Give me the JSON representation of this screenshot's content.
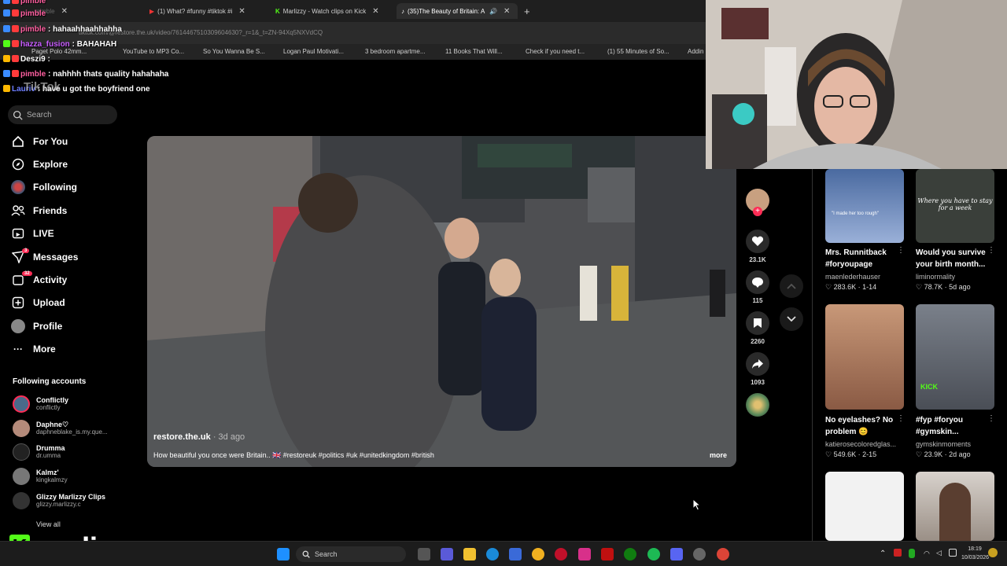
{
  "browser": {
    "tabs": [
      {
        "title": "pimble",
        "active": false
      },
      {
        "title": "(1) What? #funny #tiktok #i",
        "active": false
      },
      {
        "title": "Marlizzy - Watch clips on Kick",
        "active": false
      },
      {
        "title": "(35)The Beauty of Britain: A",
        "active": true
      }
    ],
    "new_tab": "+",
    "url": "tiktok.com/@restore.the.uk/video/7614467510309604630?_r=1&_t=ZN-94Xq5NXVdCQ",
    "bookmarks": [
      "Paget Polo 42mm...",
      "YouTube to MP3 Co...",
      "So You Wanna Be S...",
      "Logan Paul Motivati...",
      "3 bedroom apartme...",
      "11 Books That Will...",
      "Check if you need t...",
      "(1) 55 Minutes of So...",
      "Addin"
    ]
  },
  "chat": [
    {
      "user": "pimble",
      "message": "",
      "color": "#ff5fa0"
    },
    {
      "user": "pimble",
      "message": "hahaahhaahhahha",
      "color": "#ff5fa0"
    },
    {
      "user": "hazza_fusion",
      "message": "BAHAHAH",
      "color": "#c85cff"
    },
    {
      "user": "Deszi9",
      "message": "",
      "color": "#ffffff"
    },
    {
      "user": "pimble",
      "message": "nahhhh thats quality hahahaha",
      "color": "#ff5fa0"
    },
    {
      "user": "Lauriv",
      "message": "have u got the boyfriend one",
      "color": "#6b7cff"
    }
  ],
  "tiktok": {
    "logo": "TikTok",
    "search_placeholder": "Search",
    "nav": [
      {
        "label": "For You",
        "icon": "home-icon",
        "active": true
      },
      {
        "label": "Explore",
        "icon": "compass-icon"
      },
      {
        "label": "Following",
        "icon": "following-icon"
      },
      {
        "label": "Friends",
        "icon": "friends-icon"
      },
      {
        "label": "LIVE",
        "icon": "live-icon"
      },
      {
        "label": "Messages",
        "icon": "messages-icon",
        "badge": "3"
      },
      {
        "label": "Activity",
        "icon": "activity-icon",
        "badge": "32"
      },
      {
        "label": "Upload",
        "icon": "upload-icon"
      },
      {
        "label": "Profile",
        "icon": "profile-icon"
      },
      {
        "label": "More",
        "icon": "more-icon"
      }
    ],
    "following_title": "Following accounts",
    "accounts": [
      {
        "name": "Conflictly",
        "handle": "conflictly",
        "color": "#4a6a8a"
      },
      {
        "name": "Daphne♡",
        "handle": "daphneblake_is.my.que...",
        "color": "#b48a7a"
      },
      {
        "name": "Drumma",
        "handle": "dr.umma",
        "color": "#222222"
      },
      {
        "name": "Kalmz'",
        "handle": "kingkalmzy",
        "color": "#777777"
      },
      {
        "name": "Glizzy Marlizzy Clips",
        "handle": "glizzy.marlizzy.c",
        "color": "#333333"
      }
    ],
    "see_all": "View all",
    "video": {
      "author": "restore.the.uk",
      "age": "· 3d ago",
      "description": "How beautiful you once were Britain.. 🇬🇧 #restoreuk #politics #uk #unitedkingdom #british",
      "more": "more"
    },
    "actions": {
      "likes": "23.1K",
      "comments": "115",
      "saves": "2260",
      "shares": "1093"
    },
    "recommended": [
      {
        "title": "Mrs. Runnitback #foryoupage",
        "user": "maenlederhauser",
        "views": "283.6K",
        "date": "1-14",
        "thumb": "#6a8cc0",
        "caption": "\"I made her too rough\""
      },
      {
        "title": "Would you survive your birth month...",
        "user": "liminormality",
        "views": "78.7K",
        "date": "5d ago",
        "thumb": "#3a3f3a",
        "caption": "Where you have to stay for a week"
      },
      {
        "title": "No eyelashes? No problem 😊",
        "user": "katierosecoloredglas...",
        "views": "549.6K",
        "date": "2-15",
        "thumb": "#b8866a",
        "caption": ""
      },
      {
        "title": "#fyp #foryou #gymskin...",
        "user": "gymskinmoments",
        "views": "23.9K",
        "date": "2d ago",
        "thumb": "#6a6e78",
        "caption": "KICK"
      },
      {
        "title": "",
        "user": "",
        "views": "",
        "date": "",
        "thumb": "#f2f2f2",
        "caption": ""
      },
      {
        "title": "",
        "user": "",
        "views": "",
        "date": "",
        "thumb": "#9a8f86",
        "caption": ""
      }
    ]
  },
  "taskbar": {
    "search": "Search",
    "time": "18:19",
    "date": "10/03/2026"
  },
  "brand": {
    "letter": "K",
    "name": "marlizzy"
  }
}
